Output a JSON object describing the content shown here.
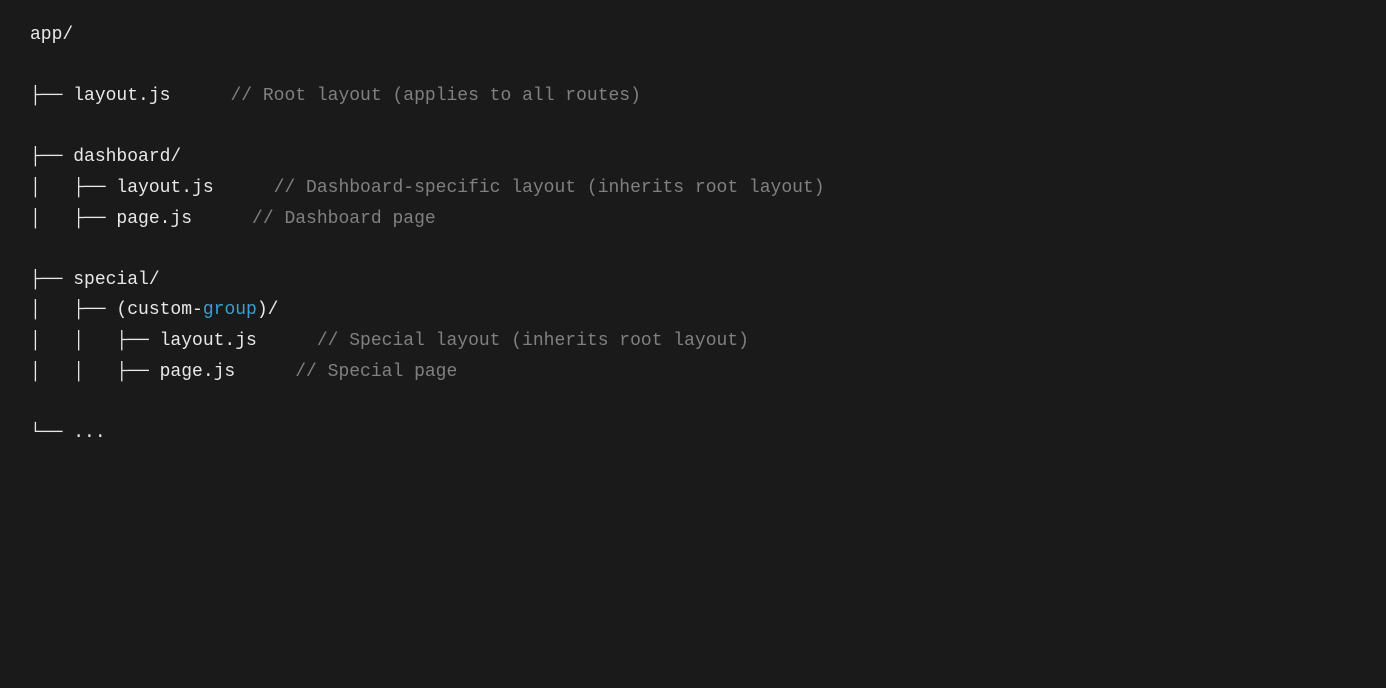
{
  "tree": {
    "root": "app/",
    "lines": [
      {
        "id": "root-label",
        "indent": 0,
        "prefix": "",
        "filename": "app/",
        "comment": ""
      },
      {
        "id": "blank-1",
        "blank": true
      },
      {
        "id": "layout-root",
        "indent": 0,
        "prefix": "├── ",
        "filename": "layout.js",
        "comment": "// Root layout (applies to all routes)"
      },
      {
        "id": "blank-2",
        "blank": true
      },
      {
        "id": "dashboard-dir",
        "indent": 0,
        "prefix": "├── ",
        "filename": "dashboard/",
        "comment": ""
      },
      {
        "id": "dashboard-layout",
        "indent": 1,
        "prefix": "│   ├── ",
        "filename": "layout.js",
        "comment": "// Dashboard-specific layout (inherits root layout)"
      },
      {
        "id": "dashboard-page",
        "indent": 1,
        "prefix": "│   ├── ",
        "filename": "page.js",
        "comment": "// Dashboard page"
      },
      {
        "id": "blank-3",
        "blank": true
      },
      {
        "id": "special-dir",
        "indent": 0,
        "prefix": "├── ",
        "filename": "special/",
        "comment": ""
      },
      {
        "id": "custom-group-dir",
        "indent": 1,
        "prefix": "│   ├── ",
        "filename_parts": [
          "(custom-",
          "group",
          ")/"
        ],
        "comment": ""
      },
      {
        "id": "special-layout",
        "indent": 2,
        "prefix": "│   │   ├── ",
        "filename": "layout.js",
        "comment": "// Special layout (inherits root layout)"
      },
      {
        "id": "special-page",
        "indent": 2,
        "prefix": "│   │   ├── ",
        "filename": "page.js",
        "comment": "// Special page"
      },
      {
        "id": "blank-4",
        "blank": true
      },
      {
        "id": "ellipsis",
        "indent": 0,
        "prefix": "└── ",
        "filename": "...",
        "comment": ""
      }
    ]
  }
}
